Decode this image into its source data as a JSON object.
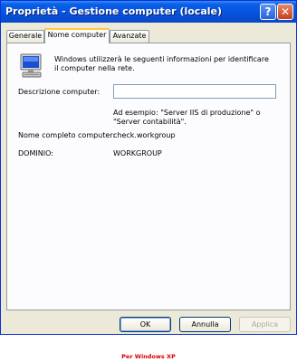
{
  "window": {
    "title": "Proprietà - Gestione computer (locale)",
    "help_label": "?",
    "close_label": "✕"
  },
  "tabs": [
    {
      "label": "Generale"
    },
    {
      "label": "Nome computer"
    },
    {
      "label": "Avanzate"
    }
  ],
  "panel": {
    "info_text": "Windows utilizzerà le seguenti informazioni per identificare il computer nella rete.",
    "description_label": "Descrizione computer:",
    "description_value": "",
    "example_text": "Ad esempio: \"Server IIS di produzione\" o \"Server contabilità\".",
    "full_name_label": "Nome completo computer:",
    "full_name_value": "check.workgroup",
    "domain_label": "DOMINIO:",
    "domain_value": "WORKGROUP"
  },
  "buttons": {
    "ok": "OK",
    "cancel": "Annulla",
    "apply": "Applica"
  },
  "caption": "Per Windows XP",
  "colors": {
    "titlebar": "#0653e0",
    "active_tab_accent": "#ffc83c",
    "caption": "#d40000"
  },
  "icons": [
    "help-icon",
    "close-icon",
    "computer-icon"
  ]
}
